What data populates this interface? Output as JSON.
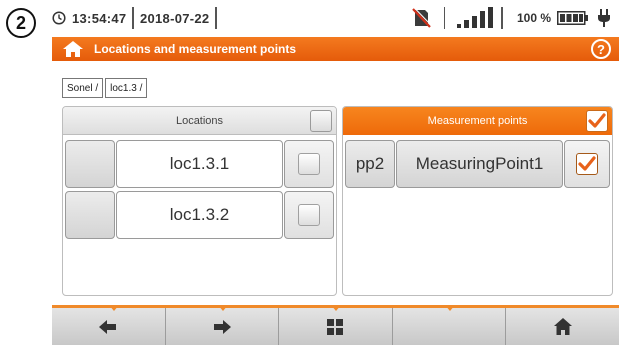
{
  "step_badge": "2",
  "status": {
    "time": "13:54:47",
    "date": "2018-07-22",
    "battery_percent": "100 %",
    "signal_bars": 5
  },
  "title": "Locations and measurement points",
  "breadcrumb": [
    "Sonel /",
    "loc1.3 /"
  ],
  "locations": {
    "header": "Locations",
    "header_checked": false,
    "rows": [
      {
        "name": "loc1.3.1",
        "checked": false
      },
      {
        "name": "loc1.3.2",
        "checked": false
      }
    ]
  },
  "measurement_points": {
    "header": "Measurement points",
    "header_checked": true,
    "rows": [
      {
        "id": "pp2",
        "name": "MeasuringPoint1",
        "checked": true
      }
    ]
  },
  "nav": {
    "buttons": [
      "back-arrow-icon",
      "forward-arrow-icon",
      "grid-icon",
      "empty",
      "home-icon"
    ]
  },
  "colors": {
    "accent": "#f07818",
    "header_orange": "#ee6a0a",
    "check_orange": "#e8621a"
  }
}
